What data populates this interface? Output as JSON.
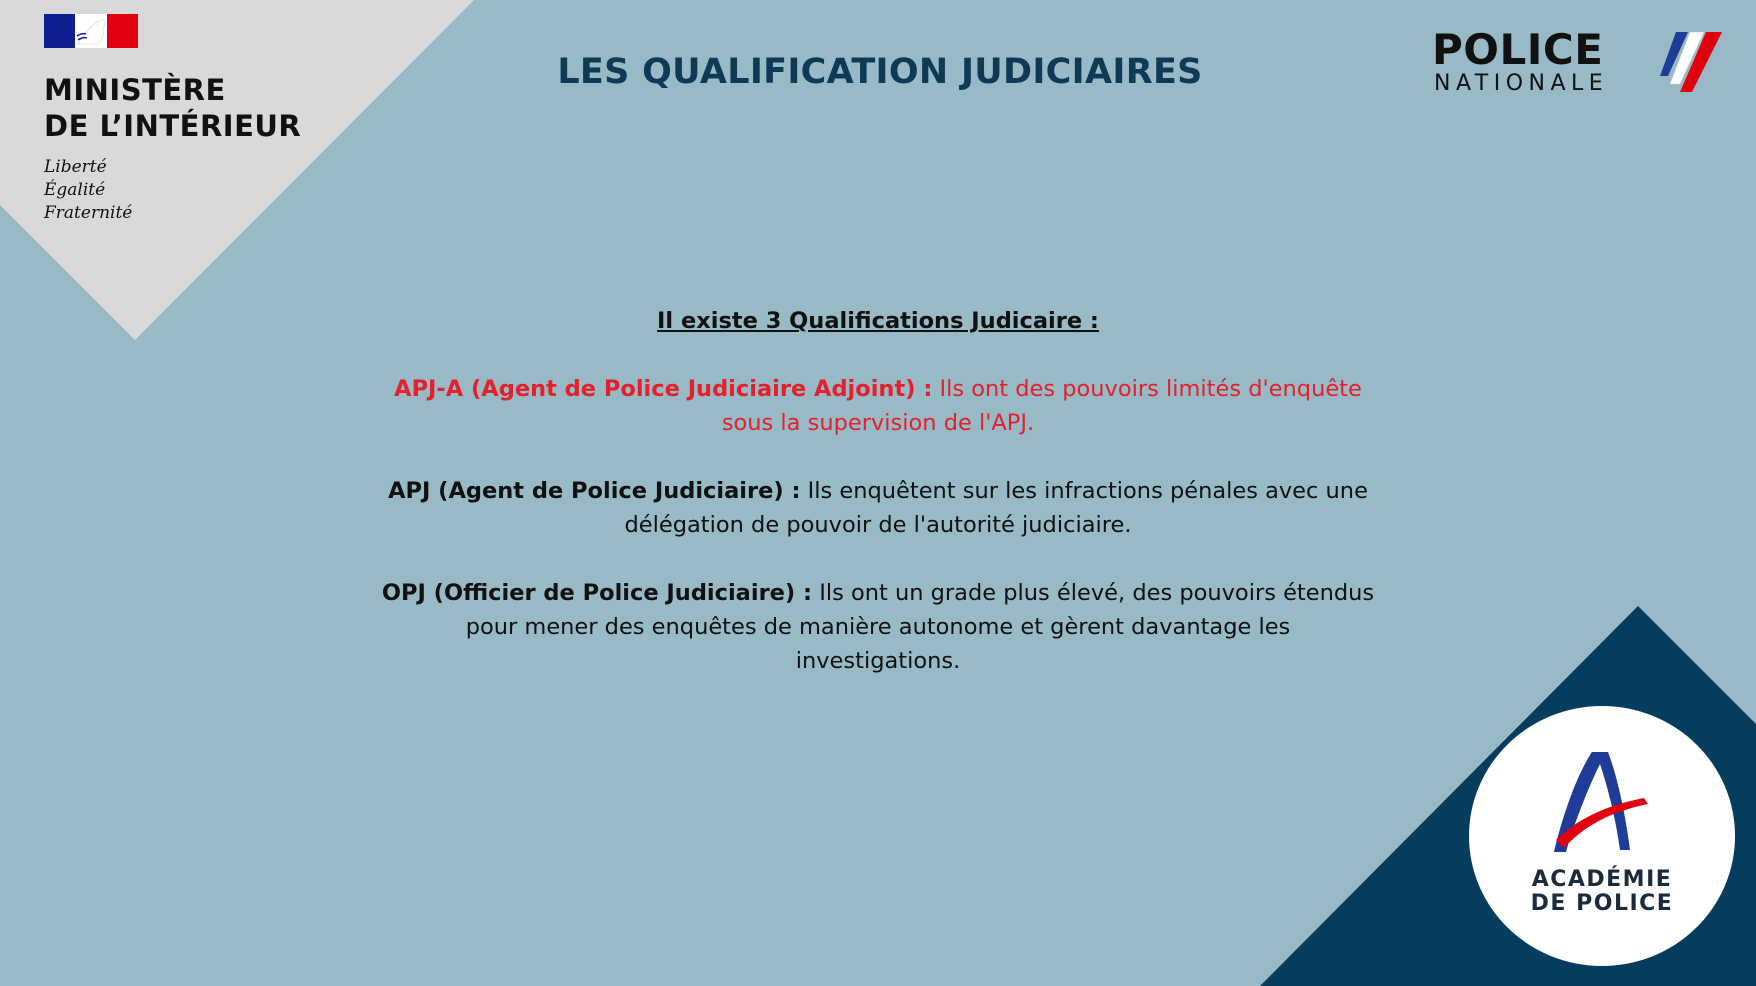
{
  "colors": {
    "background": "#97bac6",
    "ministry_panel": "#d9d9d9",
    "corner_navy": "#063d5e",
    "title": "#0f3a55",
    "highlight_red": "#e3202b",
    "body_text": "#111111"
  },
  "ministry": {
    "line1": "MINISTÈRE",
    "line2": "DE L’INTÉRIEUR",
    "motto": [
      "Liberté",
      "Égalité",
      "Fraternité"
    ]
  },
  "title": "LES QUALIFICATION JUDICIAIRES",
  "police_logo": {
    "word1": "POLICE",
    "word2": "NATIONALE"
  },
  "content": {
    "intro": "Il existe 3 Qualifications Judicaire :",
    "items": [
      {
        "term": "APJ-A (Agent de Police Judiciaire Adjoint) :",
        "text": " Ils ont des pouvoirs limités d'enquête sous la supervision de l'APJ."
      },
      {
        "term": "APJ (Agent de Police Judiciaire) :",
        "text": " Ils enquêtent sur les infractions pénales avec une délégation de pouvoir de l'autorité judiciaire."
      },
      {
        "term": "OPJ (Officier de Police Judiciaire) :",
        "text": " Ils ont un grade plus élevé, des pouvoirs étendus pour mener des enquêtes de manière autonome et gèrent davantage les investigations."
      }
    ]
  },
  "academy": {
    "line1": "ACADÉMIE",
    "line2": "DE POLICE"
  }
}
